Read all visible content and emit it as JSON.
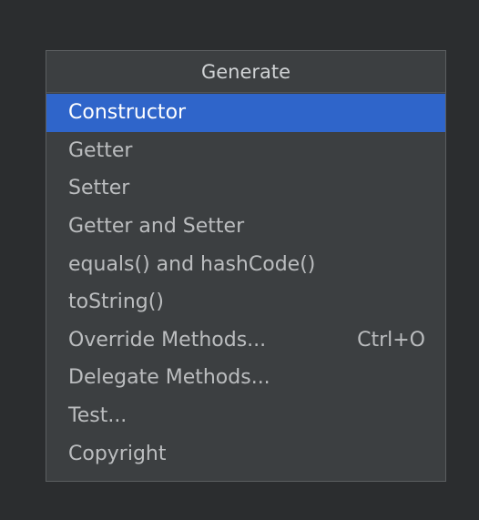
{
  "popup": {
    "title": "Generate",
    "items": [
      {
        "label": "Constructor",
        "shortcut": "",
        "selected": true
      },
      {
        "label": "Getter",
        "shortcut": ""
      },
      {
        "label": "Setter",
        "shortcut": ""
      },
      {
        "label": "Getter and Setter",
        "shortcut": ""
      },
      {
        "label": "equals() and hashCode()",
        "shortcut": ""
      },
      {
        "label": "toString()",
        "shortcut": ""
      },
      {
        "label": "Override Methods...",
        "shortcut": "Ctrl+O"
      },
      {
        "label": "Delegate Methods...",
        "shortcut": ""
      },
      {
        "label": "Test...",
        "shortcut": ""
      },
      {
        "label": "Copyright",
        "shortcut": ""
      }
    ]
  },
  "colors": {
    "background": "#2b2d2f",
    "popup_bg": "#3c3f41",
    "selection": "#2f65ca",
    "text": "#bbbdbf"
  }
}
